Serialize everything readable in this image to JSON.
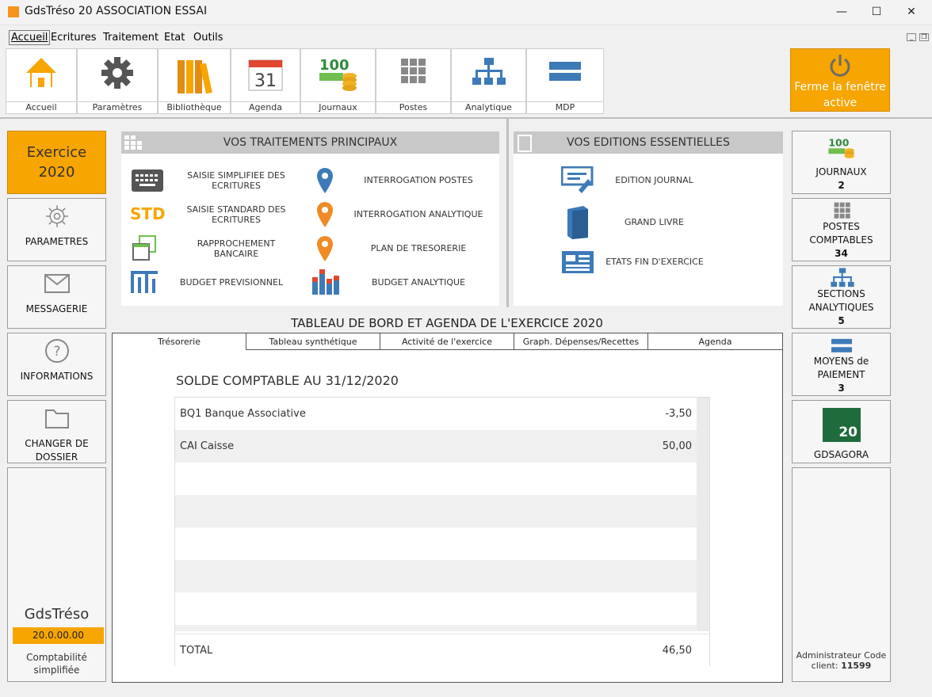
{
  "window": {
    "title": "GdsTréso 20 ASSOCIATION ESSAI",
    "minimize": "—",
    "maximize": "☐",
    "close": "✕"
  },
  "menu": [
    "Accueil",
    "Ecritures",
    "Traitement",
    "Etat",
    "Outils"
  ],
  "toolbar": {
    "items": [
      "Accueil",
      "Paramètres",
      "Bibliothèque",
      "Agenda",
      "Journaux",
      "Postes",
      "Analytique",
      "MDP"
    ],
    "agenda_day": "31",
    "journaux_num": "100",
    "close_label": "Ferme la fenêtre active"
  },
  "left": {
    "exercice": "Exercice 2020",
    "parametres": "PARAMETRES",
    "messagerie": "MESSAGERIE",
    "informations": "INFORMATIONS",
    "changer": "CHANGER DE DOSSIER",
    "app_name": "GdsTréso",
    "version": "20.0.00.00",
    "subtitle": "Comptabilité simplifiée"
  },
  "traitements": {
    "title": "VOS TRAITEMENTS PRINCIPAUX",
    "std_icon": "STD",
    "items": [
      "SAISIE SIMPLIFIEE DES ECRITURES",
      "INTERROGATION POSTES",
      "SAISIE STANDARD DES ECRITURES",
      "INTERROGATION ANALYTIQUE",
      "RAPPROCHEMENT BANCAIRE",
      "PLAN DE TRESORERIE",
      "BUDGET PREVISIONNEL",
      "BUDGET ANALYTIQUE"
    ]
  },
  "editions": {
    "title": "VOS EDITIONS  ESSENTIELLES",
    "items": [
      "EDITION JOURNAL",
      "GRAND LIVRE",
      "ETATS FIN D'EXERCICE"
    ]
  },
  "right": {
    "journaux": "JOURNAUX",
    "journaux_count": "2",
    "postes": "POSTES COMPTABLES",
    "postes_count": "34",
    "sections": "SECTIONS ANALYTIQUES",
    "sections_count": "5",
    "moyens": "MOYENS de PAIEMENT",
    "moyens_count": "3",
    "gdsagora_num": "20",
    "gdsagora": "GDSAGORA",
    "admin": "Administrateur Code client:",
    "client_code": "11599"
  },
  "dashboard": {
    "title": "TABLEAU DE BORD ET AGENDA DE L'EXERCICE 2020",
    "tabs": [
      "Trésorerie",
      "Tableau synthétique",
      "Activité de l'exercice",
      "Graph. Dépenses/Recettes",
      "Agenda"
    ],
    "solde_title": "SOLDE COMPTABLE AU 31/12/2020",
    "rows": [
      {
        "name": "BQ1 Banque Associative",
        "amount": "-3,50"
      },
      {
        "name": "CAI Caisse",
        "amount": "50,00"
      }
    ],
    "total_label": "TOTAL",
    "total": "46,50"
  },
  "colors": {
    "orange": "#f7a500",
    "blue": "#3d7ab8",
    "grey_head": "#c8c8c8"
  }
}
